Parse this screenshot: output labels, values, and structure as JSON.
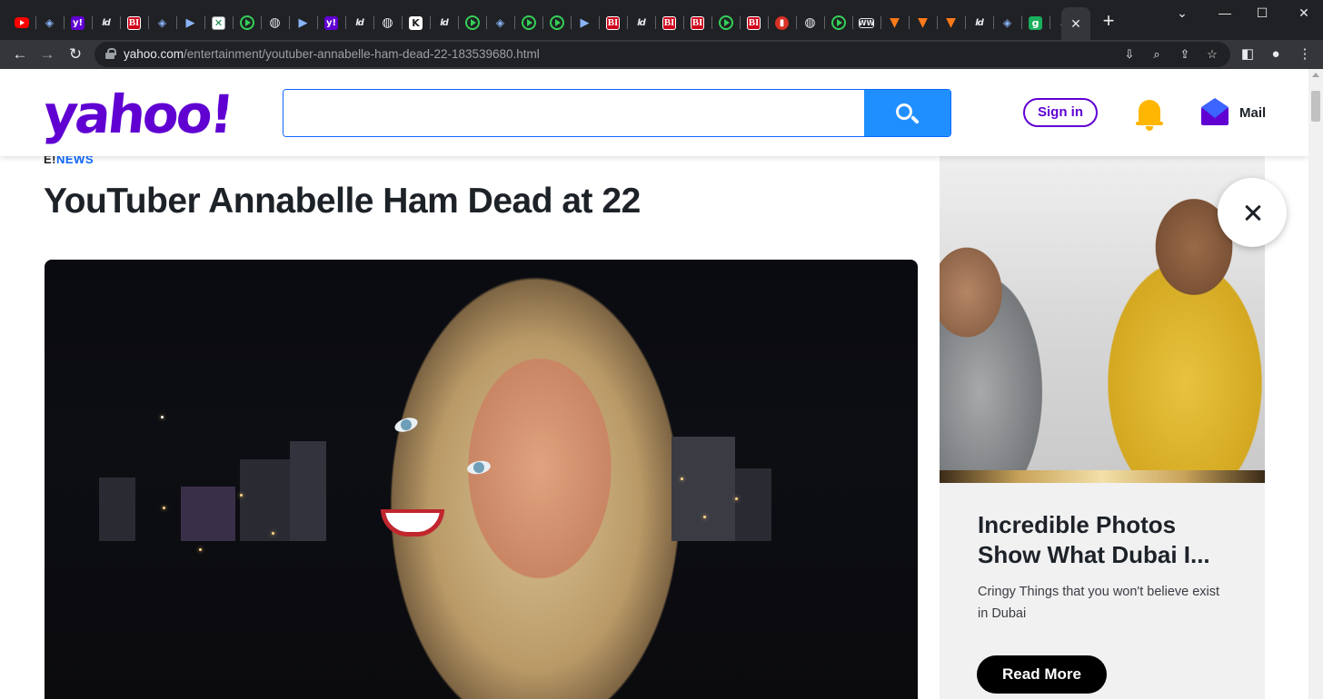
{
  "browser": {
    "tab_favicons": [
      "youtube-icon",
      "shield-icon",
      "yahoo-icon",
      "ld-icon",
      "bi-icon",
      "shield-icon",
      "d-icon",
      "sheets-icon",
      "play-icon",
      "globe-icon",
      "d-icon",
      "yahoo-icon",
      "ld-icon",
      "globe-icon",
      "k-icon",
      "ld-icon",
      "play-icon",
      "shield-icon",
      "play-icon",
      "play-icon",
      "d-icon",
      "bi-icon",
      "ld-icon",
      "bi-icon",
      "bi-icon",
      "play-icon",
      "bi-icon",
      "mic-icon",
      "globe-icon",
      "play-icon",
      "ww-icon",
      "bookmark-icon",
      "bookmark-icon",
      "bookmark-icon",
      "ld-icon",
      "shield-icon",
      "g-icon",
      "search-icon"
    ],
    "tab_labels": {
      "yahoo": "y!",
      "ld": "ld",
      "bi": "BI",
      "sheets": "✕",
      "k": "K",
      "mic": "▮",
      "ww": "WW",
      "g": "g"
    },
    "url_host": "yahoo.com",
    "url_path": "/entertainment/youtuber-annabelle-ham-dead-22-183539680.html"
  },
  "header": {
    "logo": "yahoo!",
    "search_placeholder": "",
    "signin_label": "Sign in",
    "mail_label": "Mail"
  },
  "article": {
    "source_prefix": "E!",
    "source_name": "NEWS",
    "headline": "YouTuber Annabelle Ham Dead at 22"
  },
  "ad": {
    "title": "Incredible Photos Show What Dubai I...",
    "description": "Cringy Things that you won't believe exist in Dubai",
    "button_label": "Read More"
  },
  "colors": {
    "yahoo_purple": "#6001d2",
    "search_blue": "#1f8fff",
    "chrome_dark": "#202124",
    "ad_button": "#000000"
  }
}
